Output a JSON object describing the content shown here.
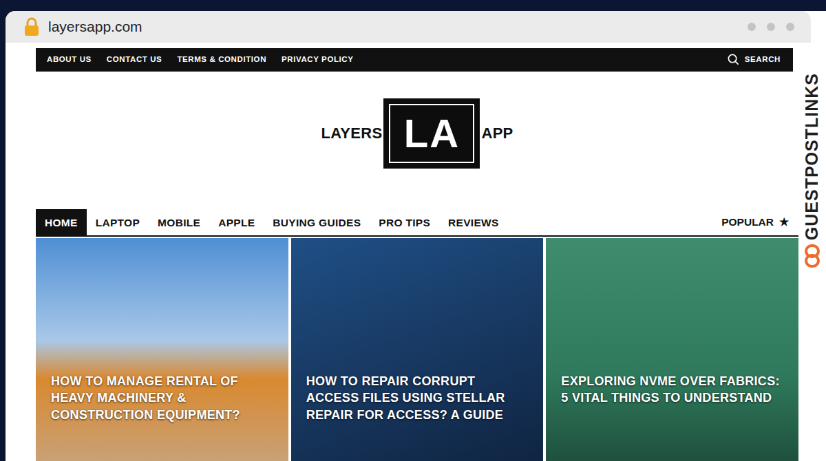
{
  "browser": {
    "address": "layersapp.com"
  },
  "topbar": {
    "links": [
      "ABOUT US",
      "CONTACT US",
      "TERMS & CONDITION",
      "PRIVACY POLICY"
    ],
    "search": "SEARCH"
  },
  "logo": {
    "left": "LAYERS",
    "mark": "LA",
    "right": "APP"
  },
  "nav": {
    "items": [
      {
        "label": "HOME",
        "selected": true
      },
      {
        "label": "LAPTOP",
        "selected": false
      },
      {
        "label": "MOBILE",
        "selected": false
      },
      {
        "label": "APPLE",
        "selected": false
      },
      {
        "label": "BUYING GUIDES",
        "selected": false
      },
      {
        "label": "PRO TIPS",
        "selected": false
      },
      {
        "label": "REVIEWS",
        "selected": false
      }
    ],
    "popular": "POPULAR",
    "popular_icon": "★"
  },
  "featured": [
    {
      "title": "HOW TO MANAGE RENTAL OF HEAVY MACHINERY & CONSTRUCTION EQUIPMENT?"
    },
    {
      "title": "HOW TO REPAIR CORRUPT ACCESS FILES USING STELLAR REPAIR FOR ACCESS? A GUIDE"
    },
    {
      "title": "EXPLORING NVME OVER FABRICS: 5 VITAL THINGS TO UNDERSTAND"
    }
  ],
  "watermark": "GUESTPOSTLINKS"
}
